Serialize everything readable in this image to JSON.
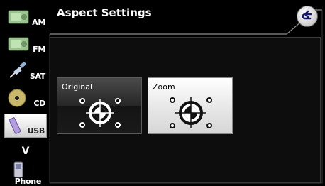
{
  "sidebar": {
    "items": [
      {
        "label": "AM",
        "icon": "radio-am-icon"
      },
      {
        "label": "FM",
        "icon": "radio-fm-icon"
      },
      {
        "label": "SAT",
        "icon": "satellite-icon"
      },
      {
        "label": "CD",
        "icon": "disc-icon"
      },
      {
        "label": "USB",
        "icon": "usb-icon",
        "selected": true
      }
    ],
    "more": "V",
    "phone": "Phone"
  },
  "header": {
    "title": "Aspect Settings",
    "back_icon": "back-arrow-icon"
  },
  "options": [
    {
      "label": "Original",
      "icon": "aspect-original-icon"
    },
    {
      "label": "Zoom",
      "icon": "aspect-zoom-icon",
      "selected": true
    }
  ]
}
